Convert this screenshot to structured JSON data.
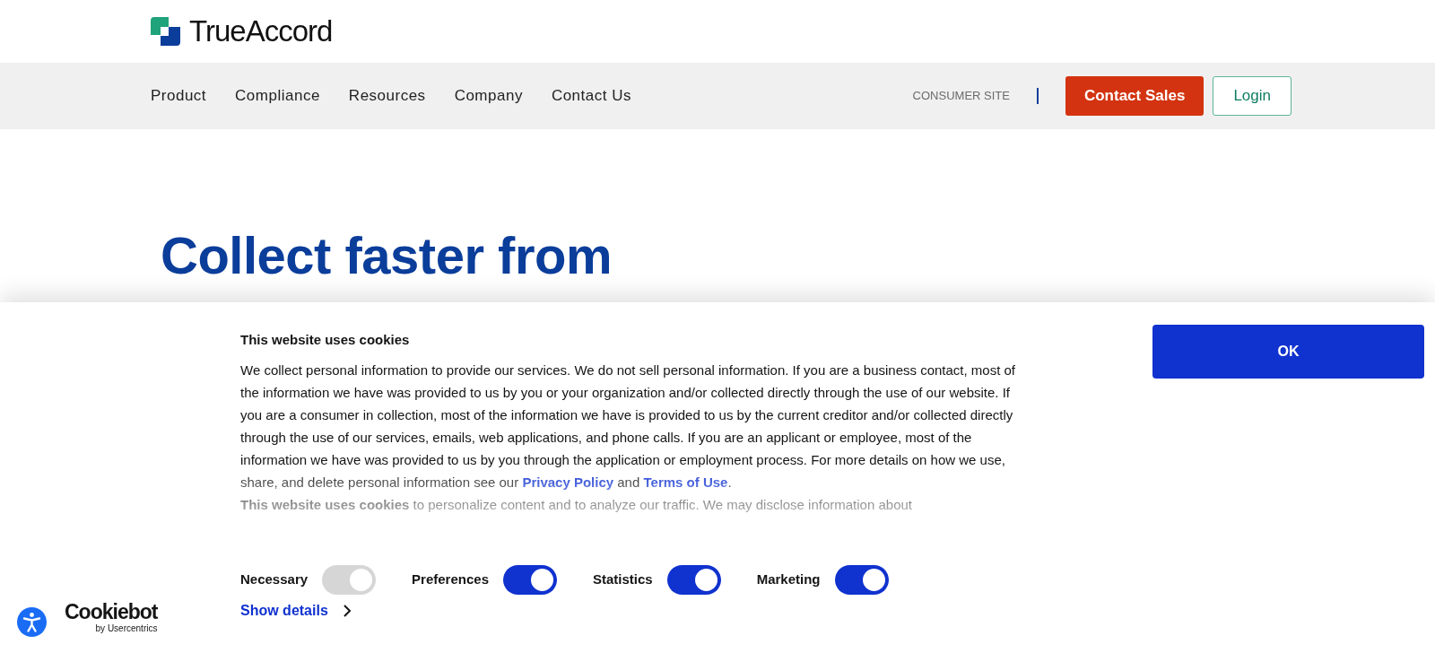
{
  "header": {
    "logo_text": "TrueAccord"
  },
  "nav": {
    "items": [
      {
        "label": "Product"
      },
      {
        "label": "Compliance"
      },
      {
        "label": "Resources"
      },
      {
        "label": "Company"
      },
      {
        "label": "Contact Us"
      }
    ],
    "consumer_link": "CONSUMER SITE",
    "primary_button": "Contact Sales",
    "secondary_button": "Login"
  },
  "hero": {
    "heading": "Collect faster from"
  },
  "cookie_banner": {
    "title": "This website uses cookies",
    "intro": "We collect personal information to provide our services. We do not sell personal information. If you are a business contact, most of the information we have was provided to us by you or your organization and/or collected directly through the use of our website. If you are a consumer in collection, most of the information we have is provided to us by the current creditor and/or collected directly through the use of our services, emails, web applications, and phone calls. If you are an applicant or employee, most of the information we have was provided to us by you through the application or employment process. For more details on how we use, share, and delete personal information see our",
    "links": [
      "Privacy Policy",
      "Terms of Use"
    ],
    "link_joiner": "and",
    "intro_end": ".",
    "second_paragraph": "**This website uses cookies** to personalize content and to analyze our traffic.  We may disclose information about",
    "ok_button": "OK",
    "toggles": [
      {
        "label": "Necessary",
        "on": true,
        "disabled": true
      },
      {
        "label": "Preferences",
        "on": true,
        "disabled": false
      },
      {
        "label": "Statistics",
        "on": true,
        "disabled": false
      },
      {
        "label": "Marketing",
        "on": true,
        "disabled": false
      }
    ],
    "show_details": "Show details",
    "brand": {
      "name": "Cookiebot",
      "byline": "by Usercentrics"
    }
  }
}
